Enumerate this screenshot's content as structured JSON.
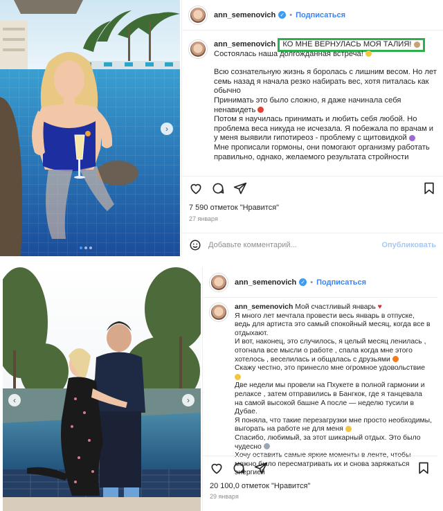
{
  "post1": {
    "username": "ann_semenovich",
    "follow_label": "Подписаться",
    "caption_first_line": "КО МНЕ ВЕРНУЛАСЬ МОЯ ТАЛИЯ!",
    "caption_lines": [
      "Состоялась наша долгожданная встреча!",
      "",
      "Всю сознательную жизнь я боролась с лишним весом. Но лет семь назад я начала резко набирать вес, хотя питалась как обычно",
      "Принимать это было сложно, я даже начинала себя ненавидеть",
      "Потом я научилась принимать и любить себя любой. Но проблема веса никуда не исчезала. Я побежала по врачам и у меня выявили гипотиреоз - проблему с щитовидкой",
      "Мне прописали гормоны, они помогают организму работать правильно, однако, желаемого результата стройности"
    ],
    "likes": "7 590 отметок \"Нравится\"",
    "date": "27 января",
    "comment_placeholder": "Добавьте комментарий...",
    "publish_label": "Опубликовать"
  },
  "post2": {
    "username": "ann_semenovich",
    "follow_label": "Подписаться",
    "caption_first_line": "Мой счастливый январь",
    "caption_lines": [
      "Я много лет мечтала провести весь январь в отпуске, ведь для артиста это самый спокойный месяц, когда все в отдыхают.",
      "И вот, наконец, это случилось, я целый месяц ленилась , отогнала все мысли о работе , спала когда мне этого хотелось , веселилась и общалась с друзьями",
      "Скажу честно, это принесло мне огромное удовольствие",
      "Две недели мы провели на Пхукете в полной гармонии и релаксе , затем отправились в Бангкок, где я танцевала на самой высокой башне A после — неделю тусили в Дубае.",
      "Я поняла, что такие перезагрузки мне просто необходимы, выгорать на работе не для меня",
      "Спасибо, любимый, за этот шикарный отдых. Это было чудесно",
      "Хочу оставить самые яркие моменты в ленте, чтобы можно было пересматривать их и снова заряжаться энергией"
    ],
    "likes": "20 100,0 отметок \"Нравится\"",
    "date": "29 января"
  },
  "colors": {
    "follow": "#3b82f6",
    "highlight_border": "#2eae4f",
    "verified": "#3b9cf5"
  }
}
